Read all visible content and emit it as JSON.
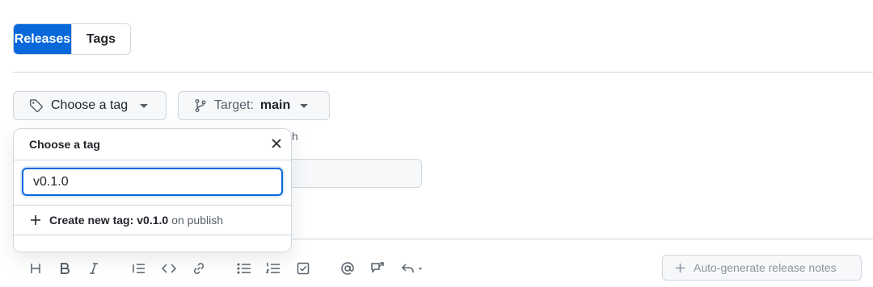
{
  "tabs": [
    {
      "label": "Releases",
      "active": true
    },
    {
      "label": "Tags",
      "active": false
    }
  ],
  "tag_button": {
    "label": "Choose a tag",
    "icon": "tag-icon"
  },
  "target_button": {
    "prefix": "Target:",
    "value": "main",
    "icon": "git-branch-icon"
  },
  "behind_text": "h",
  "popover": {
    "title": "Choose a tag",
    "input_value": "v0.1.0",
    "create_prefix": "Create new tag: ",
    "create_tag": "v0.1.0",
    "create_suffix": "on publish"
  },
  "toolbar": {
    "icons": [
      "heading-icon",
      "bold-icon",
      "italic-icon",
      "quote-icon",
      "code-icon",
      "link-icon",
      "unordered-list-icon",
      "ordered-list-icon",
      "task-list-icon",
      "mention-icon",
      "cross-reference-icon",
      "saved-replies-icon"
    ],
    "auto_generate_label": "Auto-generate release notes"
  },
  "colors": {
    "accent": "#0969da",
    "border": "#d0d7de",
    "muted": "#57606a"
  }
}
